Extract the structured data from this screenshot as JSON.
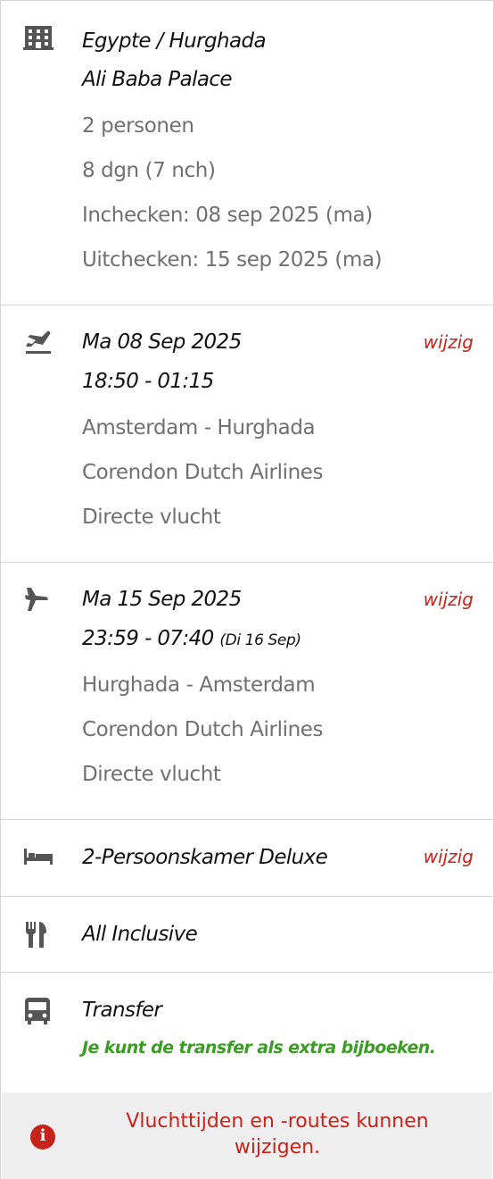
{
  "hotel": {
    "icon": "building-icon",
    "destination": "Egypte / Hurghada",
    "name": "Ali Baba Palace",
    "persons": "2 personen",
    "duration": "8 dgn (7 nch)",
    "checkin": "Inchecken: 08 sep 2025 (ma)",
    "checkout": "Uitchecken: 15 sep 2025 (ma)"
  },
  "outbound_flight": {
    "icon": "plane-departure-icon",
    "date": "Ma 08 Sep 2025",
    "times": "18:50 - 01:15",
    "route": "Amsterdam - Hurghada",
    "airline": "Corendon Dutch Airlines",
    "type": "Directe vlucht",
    "edit_label": "wijzig"
  },
  "return_flight": {
    "icon": "plane-arrival-icon",
    "date": "Ma 15 Sep 2025",
    "times": "23:59 - 07:40",
    "arrival_note": "(Di 16 Sep)",
    "route": "Hurghada - Amsterdam",
    "airline": "Corendon Dutch Airlines",
    "type": "Directe vlucht",
    "edit_label": "wijzig"
  },
  "room": {
    "icon": "bed-icon",
    "name": "2-Persoonskamer Deluxe",
    "edit_label": "wijzig"
  },
  "board": {
    "icon": "cutlery-icon",
    "name": "All Inclusive"
  },
  "transfer": {
    "icon": "bus-icon",
    "name": "Transfer",
    "note": "Je kunt de transfer als extra bijboeken."
  },
  "notice": {
    "icon": "info-icon",
    "message": "Vluchttijden en -routes kunnen wijzigen."
  },
  "colors": {
    "accent_red": "#c6231b",
    "success_green": "#3b9d24",
    "text_grey": "#707070",
    "border": "#d6d6d6"
  }
}
